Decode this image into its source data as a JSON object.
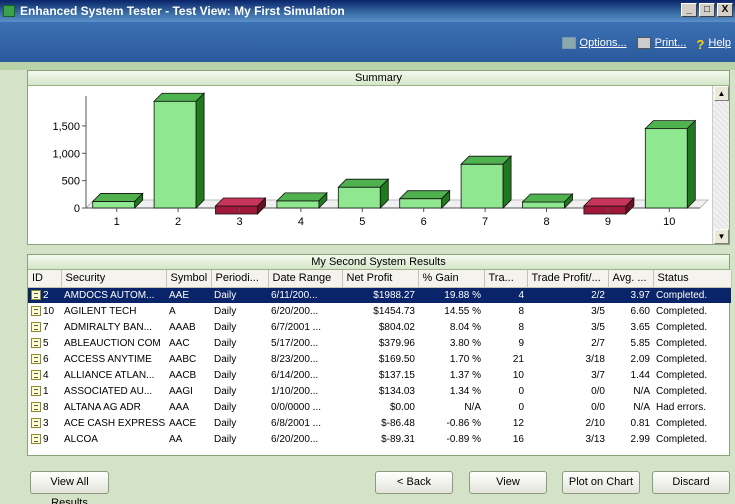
{
  "window": {
    "title": "Enhanced System Tester - Test View: My First Simulation",
    "min": "_",
    "max": "□",
    "close": "X"
  },
  "toolbar": {
    "options_label": "Options...",
    "print_label": "Print...",
    "help_label": "Help",
    "help_icon": "?"
  },
  "summary": {
    "title": "Summary",
    "chart_data": {
      "type": "bar",
      "categories": [
        "1",
        "2",
        "3",
        "4",
        "5",
        "6",
        "7",
        "8",
        "9",
        "10"
      ],
      "values": [
        120,
        1950,
        -100,
        130,
        380,
        170,
        800,
        0,
        -90,
        1450
      ],
      "ylim": [
        0,
        1900
      ],
      "yticks": [
        0,
        500,
        1000,
        1500
      ],
      "ytick_labels": [
        "0",
        "500",
        "1,000",
        "1,500"
      ],
      "colors": {
        "positive": "#8fe88f",
        "negative": "#a0183a"
      }
    }
  },
  "results": {
    "title": "My Second System Results",
    "columns": [
      "ID",
      "Security",
      "Symbol",
      "Periodi...",
      "Date Range",
      "Net Profit",
      "% Gain",
      "Tra...",
      "Trade Profit/...",
      "Avg. ...",
      "Status"
    ],
    "rows": [
      {
        "id": "2",
        "security": "AMDOCS AUTOM...",
        "symbol": "AAE",
        "period": "Daily",
        "range": "6/11/200...",
        "profit": "$1988.27",
        "gain": "19.88 %",
        "trades": "4",
        "tp": "2/2",
        "avg": "3.97",
        "status": "Completed."
      },
      {
        "id": "10",
        "security": "AGILENT TECH",
        "symbol": "A",
        "period": "Daily",
        "range": "6/20/200...",
        "profit": "$1454.73",
        "gain": "14.55 %",
        "trades": "8",
        "tp": "3/5",
        "avg": "6.60",
        "status": "Completed."
      },
      {
        "id": "7",
        "security": "ADMIRALTY BAN...",
        "symbol": "AAAB",
        "period": "Daily",
        "range": "6/7/2001 ...",
        "profit": "$804.02",
        "gain": "8.04 %",
        "trades": "8",
        "tp": "3/5",
        "avg": "3.65",
        "status": "Completed."
      },
      {
        "id": "5",
        "security": "ABLEAUCTION COM",
        "symbol": "AAC",
        "period": "Daily",
        "range": "5/17/200...",
        "profit": "$379.96",
        "gain": "3.80 %",
        "trades": "9",
        "tp": "2/7",
        "avg": "5.85",
        "status": "Completed."
      },
      {
        "id": "6",
        "security": "ACCESS ANYTIME",
        "symbol": "AABC",
        "period": "Daily",
        "range": "8/23/200...",
        "profit": "$169.50",
        "gain": "1.70 %",
        "trades": "21",
        "tp": "3/18",
        "avg": "2.09",
        "status": "Completed."
      },
      {
        "id": "4",
        "security": "ALLIANCE ATLAN...",
        "symbol": "AACB",
        "period": "Daily",
        "range": "6/14/200...",
        "profit": "$137.15",
        "gain": "1.37 %",
        "trades": "10",
        "tp": "3/7",
        "avg": "1.44",
        "status": "Completed."
      },
      {
        "id": "1",
        "security": "ASSOCIATED AU...",
        "symbol": "AAGI",
        "period": "Daily",
        "range": "1/10/200...",
        "profit": "$134.03",
        "gain": "1.34 %",
        "trades": "0",
        "tp": "0/0",
        "avg": "N/A",
        "status": "Completed."
      },
      {
        "id": "8",
        "security": "ALTANA AG ADR",
        "symbol": "AAA",
        "period": "Daily",
        "range": "0/0/0000 ...",
        "profit": "$0.00",
        "gain": "N/A",
        "trades": "0",
        "tp": "0/0",
        "avg": "N/A",
        "status": "Had errors."
      },
      {
        "id": "3",
        "security": "ACE CASH EXPRESS",
        "symbol": "AACE",
        "period": "Daily",
        "range": "6/8/2001 ...",
        "profit": "$-86.48",
        "gain": "-0.86 %",
        "trades": "12",
        "tp": "2/10",
        "avg": "0.81",
        "status": "Completed."
      },
      {
        "id": "9",
        "security": "ALCOA",
        "symbol": "AA",
        "period": "Daily",
        "range": "6/20/200...",
        "profit": "$-89.31",
        "gain": "-0.89 %",
        "trades": "16",
        "tp": "3/13",
        "avg": "2.99",
        "status": "Completed."
      }
    ]
  },
  "buttons": {
    "view_all": "View All Results",
    "back": "< Back",
    "view": "View",
    "plot": "Plot on Chart",
    "discard": "Discard"
  }
}
